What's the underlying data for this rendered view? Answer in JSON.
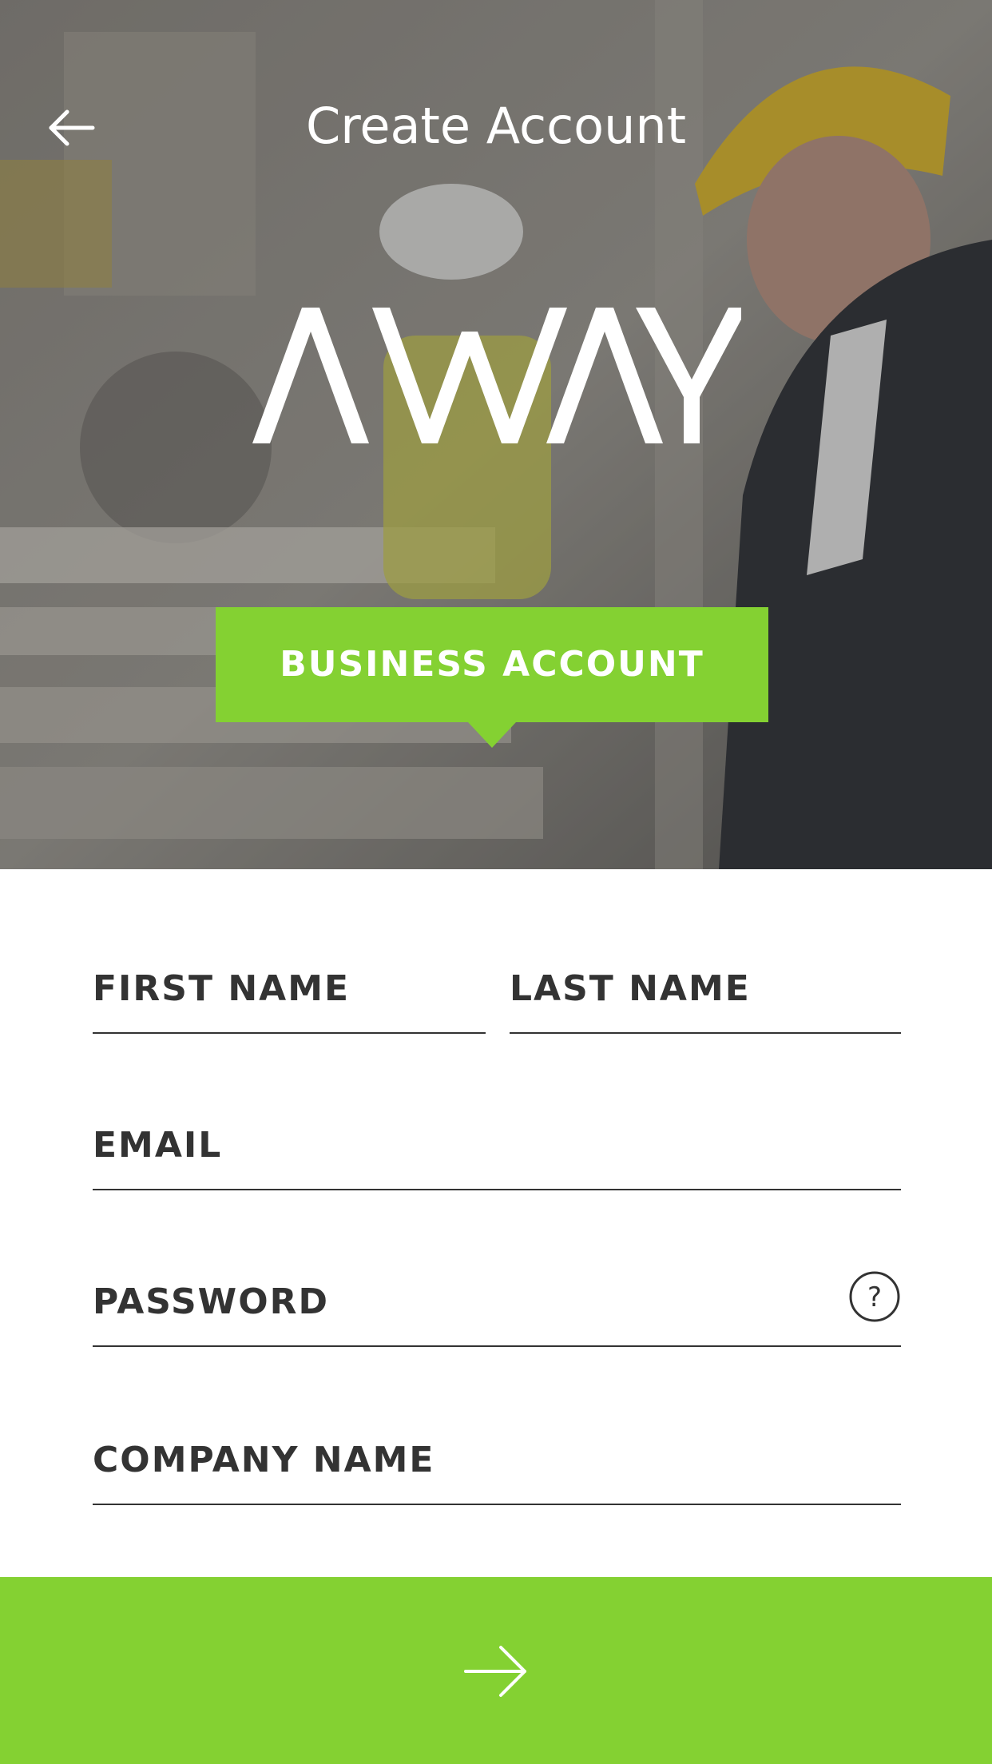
{
  "header": {
    "title": "Create Account",
    "back_icon": "arrow-left-icon"
  },
  "brand": {
    "logo_text": "AWAY"
  },
  "account_type": {
    "label": "BUSINESS ACCOUNT"
  },
  "form": {
    "first_name": {
      "placeholder": "FIRST NAME",
      "value": ""
    },
    "last_name": {
      "placeholder": "LAST NAME",
      "value": ""
    },
    "email": {
      "placeholder": "EMAIL",
      "value": ""
    },
    "password": {
      "placeholder": "PASSWORD",
      "value": "",
      "help_icon": "question-circle-icon"
    },
    "company_name": {
      "placeholder": "COMPANY NAME",
      "value": ""
    }
  },
  "submit": {
    "icon": "arrow-right-icon"
  },
  "colors": {
    "accent": "#84d132",
    "text": "#333333",
    "hero_text": "#ffffff"
  }
}
